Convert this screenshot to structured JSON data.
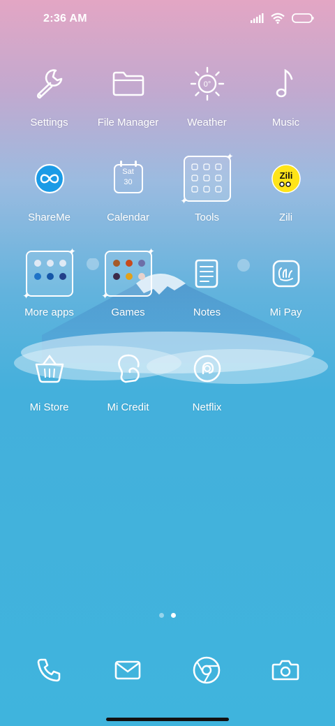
{
  "status_bar": {
    "time": "2:36 AM"
  },
  "rows": [
    [
      {
        "label": "Settings"
      },
      {
        "label": "File Manager"
      },
      {
        "label": "Weather",
        "icon_text": "0°"
      },
      {
        "label": "Music"
      }
    ],
    [
      {
        "label": "ShareMe"
      },
      {
        "label": "Calendar",
        "icon_day": "Sat",
        "icon_date": "30"
      },
      {
        "label": "Tools"
      },
      {
        "label": "Zili",
        "icon_text": "Zili"
      }
    ],
    [
      {
        "label": "More apps"
      },
      {
        "label": "Games"
      },
      {
        "label": "Notes"
      },
      {
        "label": "Mi Pay"
      }
    ],
    [
      {
        "label": "Mi Store"
      },
      {
        "label": "Mi Credit"
      },
      {
        "label": "Netflix"
      }
    ]
  ],
  "colors": {
    "shareme_blue": "#1b9be6",
    "zili_yellow": "#ffe419",
    "outline": "#ffffff"
  },
  "icons": {
    "settings": "wrench-icon",
    "file_manager": "folder-icon",
    "weather": "sun-icon",
    "music": "music-note-icon",
    "dock": [
      "phone-icon",
      "message-icon",
      "browser-icon",
      "camera-icon"
    ]
  }
}
